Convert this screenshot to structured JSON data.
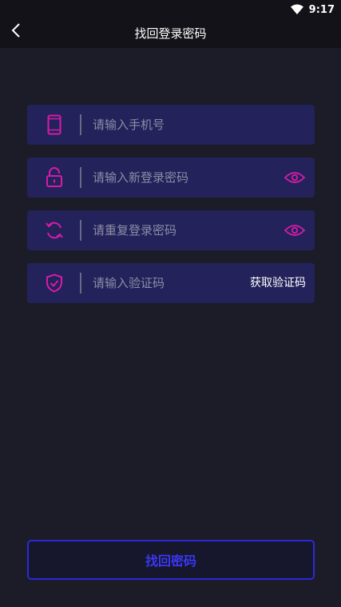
{
  "status_bar": {
    "time": "9:17",
    "wifi_icon": "wifi-icon"
  },
  "header": {
    "title": "找回登录密码",
    "back_icon": "chevron-left-icon"
  },
  "form": {
    "phone": {
      "placeholder": "请输入手机号",
      "icon": "phone-icon"
    },
    "new_password": {
      "placeholder": "请输入新登录密码",
      "icon": "lock-icon",
      "toggle_icon": "eye-icon"
    },
    "repeat_password": {
      "placeholder": "请重复登录密码",
      "icon": "refresh-icon",
      "toggle_icon": "eye-icon"
    },
    "code": {
      "placeholder": "请输入验证码",
      "icon": "shield-check-icon",
      "get_code_label": "获取验证码"
    }
  },
  "submit": {
    "label": "找回密码"
  },
  "colors": {
    "accent_pink": "#d61ba8",
    "button_blue": "#2c29d9",
    "field_bg": "#23225a",
    "page_bg": "#1b1c27"
  }
}
